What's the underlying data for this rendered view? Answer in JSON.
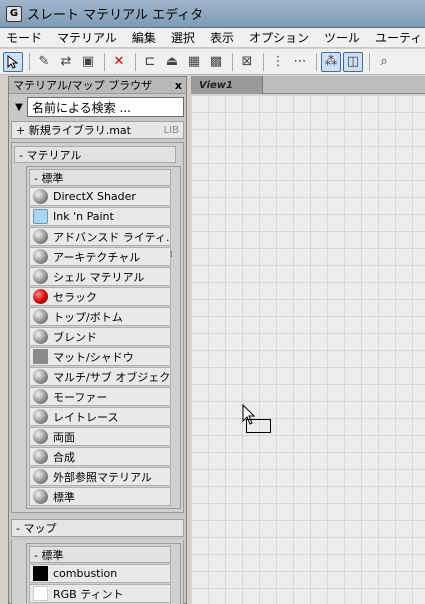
{
  "window": {
    "title": "スレート マテリアル エディタ"
  },
  "menu": [
    "モード",
    "マテリアル",
    "編集",
    "選択",
    "表示",
    "オプション",
    "ツール",
    "ユーティ"
  ],
  "panel": {
    "title": "マテリアル/マップ ブラウザ",
    "close": "x",
    "search_placeholder": "名前による検索 ...",
    "new_library": "+ 新規ライブラリ.mat",
    "lib_tag": "LIB",
    "materials_group": "- マテリアル",
    "materials_sub": "- 標準",
    "materials": [
      {
        "label": "DirectX Shader",
        "icon": "sphere-gray"
      },
      {
        "label": "Ink 'n Paint",
        "icon": "light-blue-square"
      },
      {
        "label": "アドバンスド ライティ...",
        "icon": "sphere-gray"
      },
      {
        "label": "アーキテクチャル",
        "icon": "sphere-gray"
      },
      {
        "label": "シェル マテリアル",
        "icon": "sphere-gray"
      },
      {
        "label": "セラック",
        "icon": "sphere-red"
      },
      {
        "label": "トップ/ボトム",
        "icon": "sphere-gray"
      },
      {
        "label": "ブレンド",
        "icon": "sphere-gray"
      },
      {
        "label": "マット/シャドウ",
        "icon": "gray-square"
      },
      {
        "label": "マルチ/サブ オブジェクト",
        "icon": "sphere-gray"
      },
      {
        "label": "モーファー",
        "icon": "sphere-gray"
      },
      {
        "label": "レイトレース",
        "icon": "sphere-gray"
      },
      {
        "label": "両面",
        "icon": "sphere-gray"
      },
      {
        "label": "合成",
        "icon": "sphere-gray"
      },
      {
        "label": "外部参照マテリアル",
        "icon": "sphere-gray"
      },
      {
        "label": "標準",
        "icon": "sphere-gray"
      }
    ],
    "maps_group": "- マップ",
    "maps_sub": "- 標準",
    "maps": [
      {
        "label": "combustion",
        "icon": "black-square"
      },
      {
        "label": "RGB ティント",
        "icon": "white-square"
      }
    ]
  },
  "viewport": {
    "tab": "View1"
  },
  "colors": {
    "titlebar": "#8aa3bd",
    "grid_bg": "#ececec",
    "panel_bg": "#c8c8c8"
  }
}
